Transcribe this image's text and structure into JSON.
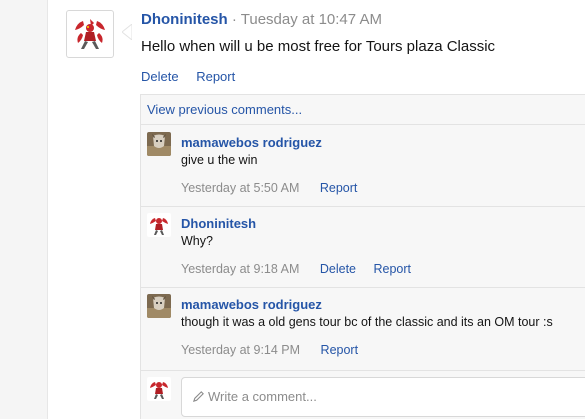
{
  "post": {
    "author": "Dhoninitesh",
    "separator": "·",
    "timestamp": "Tuesday at 10:47 AM",
    "body": "Hello when will u be most free for Tours plaza Classic",
    "actions": {
      "delete": "Delete",
      "report": "Report"
    }
  },
  "comments": {
    "view_previous": "View previous comments...",
    "items": [
      {
        "author": "mamawebos rodriguez",
        "text": "give u the win",
        "time": "Yesterday at 5:50 AM",
        "actions": [
          "Report"
        ]
      },
      {
        "author": "Dhoninitesh",
        "text": "Why?",
        "time": "Yesterday at 9:18 AM",
        "actions": [
          "Delete",
          "Report"
        ]
      },
      {
        "author": "mamawebos rodriguez",
        "text": "though it was a old gens tour bc of the classic and its an OM tour :s",
        "time": "Yesterday at 9:14 PM",
        "actions": [
          "Report"
        ]
      }
    ],
    "write_placeholder": "Write a comment..."
  },
  "colors": {
    "link": "#2555a7",
    "muted": "#8c8c8c",
    "panel": "#f7f7f7",
    "avatar_red": "#c8262c"
  },
  "icons": {
    "pencil": "pencil-icon",
    "avatar_scizor": "scizor-avatar",
    "avatar_goat": "goat-avatar"
  }
}
